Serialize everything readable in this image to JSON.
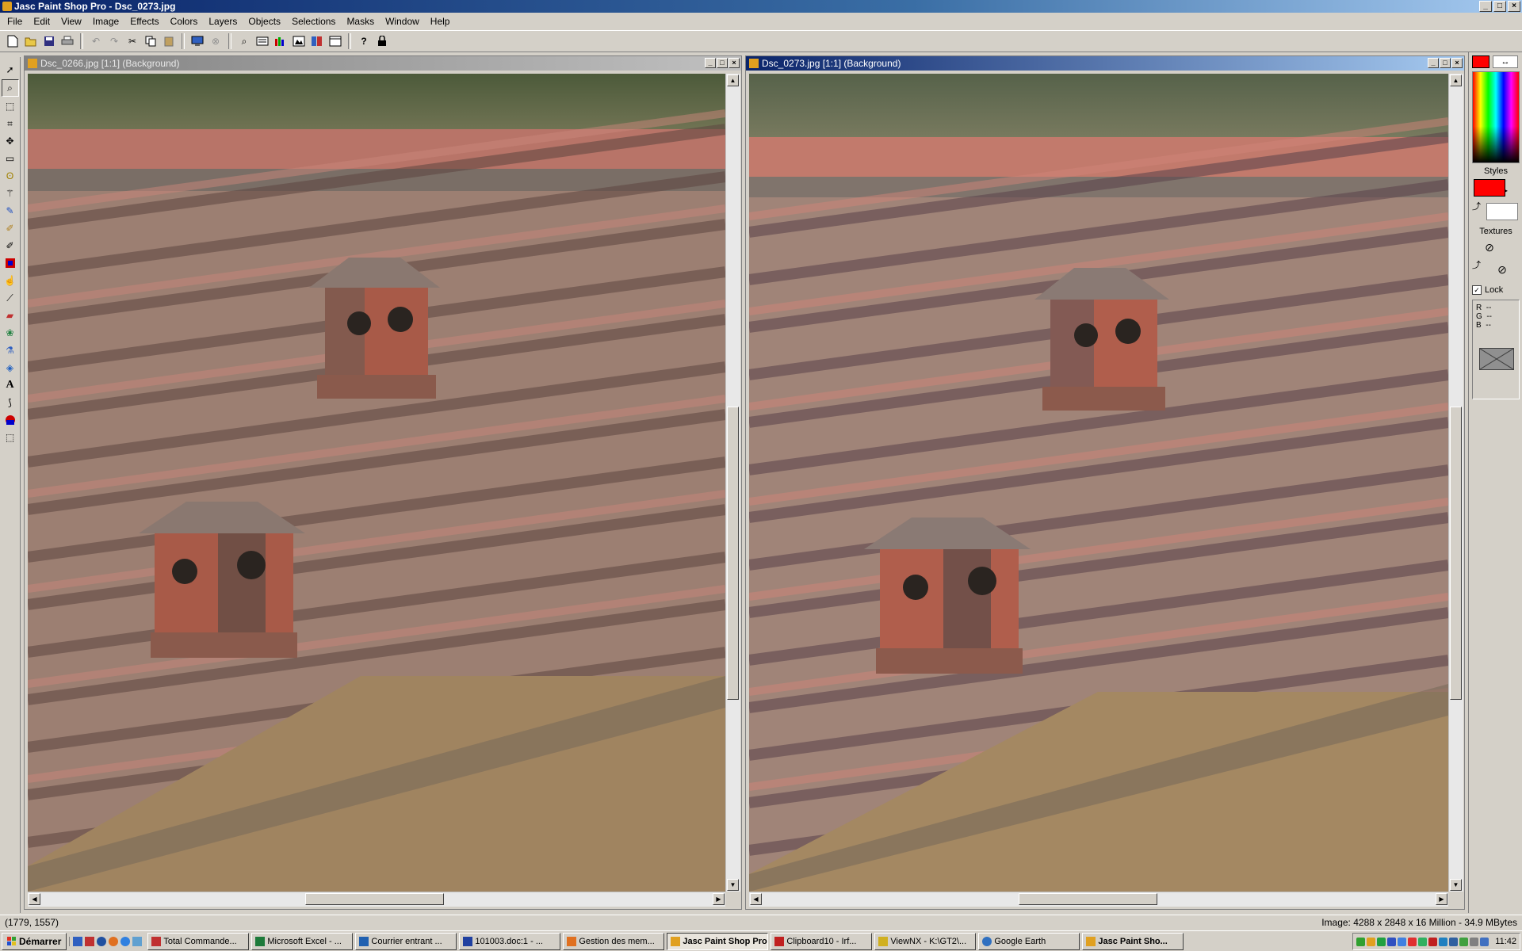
{
  "app": {
    "title": "Jasc Paint Shop Pro - Dsc_0273.jpg",
    "window_buttons": [
      "_",
      "□",
      "×"
    ]
  },
  "menu": [
    "File",
    "Edit",
    "View",
    "Image",
    "Effects",
    "Colors",
    "Layers",
    "Objects",
    "Selections",
    "Masks",
    "Window",
    "Help"
  ],
  "toolbar": {
    "icons": [
      "new-icon",
      "open-icon",
      "save-icon",
      "print-icon",
      "undo-icon",
      "redo-icon",
      "cut-icon",
      "copy-icon",
      "paste-icon",
      "browse-icon",
      "twain-icon",
      "zoom-icon",
      "layers-palette-icon",
      "histogram-icon",
      "color-palette-icon",
      "overview-icon",
      "help-icon",
      "lock-icon"
    ]
  },
  "tools": [
    "arrow-tool-icon",
    "zoom-tool-icon",
    "deform-tool-icon",
    "crop-tool-icon",
    "mover-tool-icon",
    "selection-tool-icon",
    "freehand-tool-icon",
    "magic-wand-tool-icon",
    "dropper-tool-icon",
    "paintbrush-tool-icon",
    "clone-brush-tool-icon",
    "color-replacer-tool-icon",
    "retouch-tool-icon",
    "scratch-remover-tool-icon",
    "eraser-tool-icon",
    "picture-tube-tool-icon",
    "airbrush-tool-icon",
    "flood-fill-tool-icon",
    "text-tool-icon",
    "draw-tool-icon",
    "preset-shapes-tool-icon",
    "object-selector-tool-icon"
  ],
  "documents": [
    {
      "title": "Dsc_0266.jpg [1:1] (Background)",
      "active": false
    },
    {
      "title": "Dsc_0273.jpg [1:1] (Background)",
      "active": true
    }
  ],
  "palette": {
    "styles_label": "Styles",
    "textures_label": "Textures",
    "lock_label": "Lock",
    "lock_checked": true,
    "rgb": [
      {
        "label": "R",
        "value": "--"
      },
      {
        "label": "G",
        "value": "--"
      },
      {
        "label": "B",
        "value": "--"
      }
    ],
    "foreground_color": "#ff0000",
    "background_color": "#ffffff"
  },
  "status": {
    "cursor": "(1779, 1557)",
    "image_info": "Image:  4288 x 2848 x 16 Million - 34.9 MBytes"
  },
  "taskbar": {
    "start_label": "Démarrer",
    "tasks": [
      {
        "label": "Total Commande...",
        "active": false,
        "color": "#c03030"
      },
      {
        "label": "Microsoft Excel - ...",
        "active": false,
        "color": "#1d7a3a"
      },
      {
        "label": "Courrier entrant ...",
        "active": false,
        "color": "#2060b0"
      },
      {
        "label": "101003.doc:1 - ...",
        "active": false,
        "color": "#2040a0"
      },
      {
        "label": "Gestion des mem...",
        "active": false,
        "color": "#e07020"
      },
      {
        "label": "Jasc Paint Shop Pro",
        "active": true,
        "color": "#e0a020"
      },
      {
        "label": "Clipboard10 - Irf...",
        "active": false,
        "color": "#c02020"
      },
      {
        "label": "ViewNX - K:\\GT2\\...",
        "active": false,
        "color": "#d0b020"
      },
      {
        "label": "Google Earth",
        "active": false,
        "color": "#3070c0"
      },
      {
        "label": "Jasc Paint Sho...",
        "active": false,
        "color": "#e0a020"
      }
    ],
    "clock": "11:42"
  }
}
